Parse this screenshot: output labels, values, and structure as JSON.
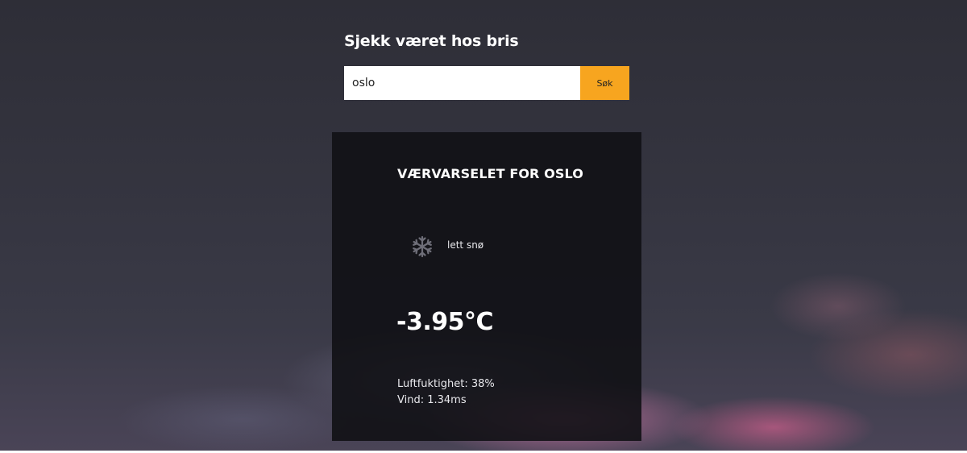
{
  "header": {
    "title": "Sjekk været hos bris"
  },
  "search": {
    "value": "oslo",
    "button_label": "Søk"
  },
  "weather": {
    "title": "VÆRVARSELET FOR OSLO",
    "icon": "snowflake-icon",
    "description": "lett snø",
    "temperature": "-3.95°C",
    "humidity": "Luftfuktighet: 38%",
    "wind": "Vind: 1.34ms"
  },
  "colors": {
    "accent": "#f7a51f",
    "card_background": "#111115",
    "text": "#ffffff"
  }
}
